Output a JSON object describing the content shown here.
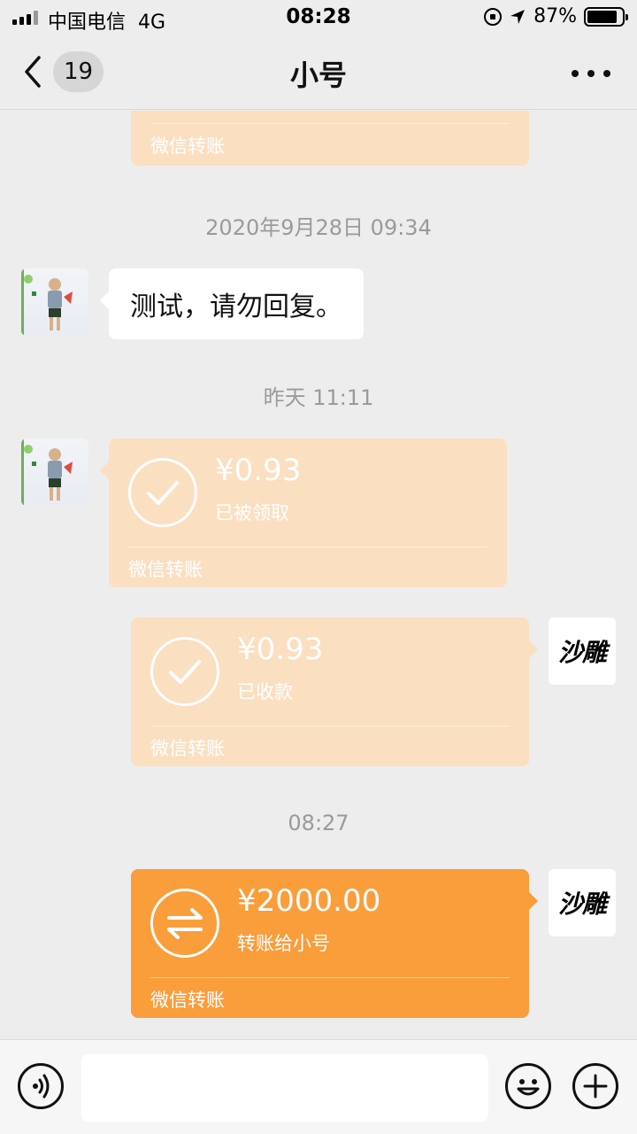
{
  "status_bar": {
    "carrier": "中国电信",
    "network": "4G",
    "time": "08:28",
    "battery": "87%",
    "battery_level": 0.87
  },
  "nav": {
    "unread_count": "19",
    "title": "小号",
    "icons": {
      "back": "chevron-left-icon",
      "more": "more-dots-icon"
    }
  },
  "messages": {
    "top_partial": {
      "footer": "微信转账"
    },
    "time_1": "2020年9月28日 09:34",
    "text_1": "测试，请勿回复。",
    "time_2": "昨天 11:11",
    "transfer_1": {
      "amount": "¥0.93",
      "status": "已被领取",
      "footer": "微信转账"
    },
    "transfer_2": {
      "amount": "¥0.93",
      "status": "已收款",
      "footer": "微信转账"
    },
    "time_3": "08:27",
    "transfer_3": {
      "amount": "¥2000.00",
      "status": "转账给小号",
      "footer": "微信转账"
    }
  },
  "self_avatar_text": "沙雕",
  "colors": {
    "background": "#ededed",
    "transfer_done": "#fbdfc1",
    "transfer_active": "#fa9d3b",
    "bubble": "#ffffff"
  },
  "input": {
    "placeholder": ""
  }
}
